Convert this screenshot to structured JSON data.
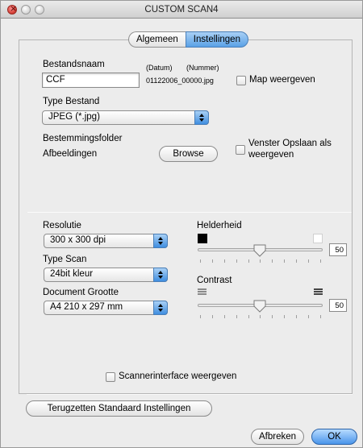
{
  "window": {
    "title": "CUSTOM SCAN4"
  },
  "tabs": [
    {
      "label": "Algemeen"
    },
    {
      "label": "Instellingen"
    }
  ],
  "file": {
    "name_label": "Bestandsnaam",
    "date_label": "(Datum)",
    "number_label": "(Nummer)",
    "name_value": "CCF",
    "filename_example": "01122006_00000.jpg",
    "show_folder_label": "Map weergeven"
  },
  "file_type": {
    "label": "Type Bestand",
    "selected": "JPEG (*.jpg)"
  },
  "destination": {
    "label": "Bestemmingsfolder",
    "folder": "Afbeeldingen",
    "browse_label": "Browse",
    "show_save_as_label_1": "Venster Opslaan als",
    "show_save_as_label_2": "weergeven"
  },
  "resolution": {
    "label": "Resolutie",
    "selected": "300 x 300 dpi"
  },
  "scan_type": {
    "label": "Type Scan",
    "selected": "24bit kleur"
  },
  "document_size": {
    "label": "Document Grootte",
    "selected": "A4  210 x 297 mm"
  },
  "brightness": {
    "label": "Helderheid",
    "value": "50"
  },
  "contrast": {
    "label": "Contrast",
    "value": "50"
  },
  "scanner_interface_label": "Scannerinterface weergeven",
  "buttons": {
    "reset": "Terugzetten Standaard Instellingen",
    "cancel": "Afbreken",
    "ok": "OK"
  }
}
